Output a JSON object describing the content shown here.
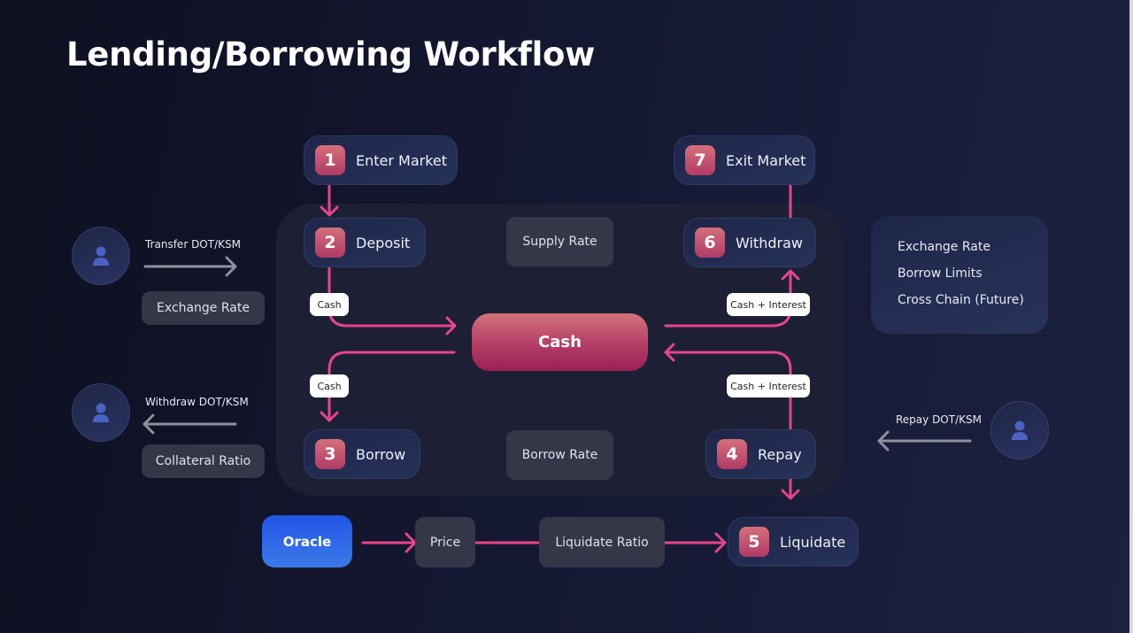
{
  "title": "Lending/Borrowing Workflow",
  "colors": {
    "accent_pink": "#e8458a",
    "badge": "#b03a66",
    "oracle_blue": "#2355e6",
    "arrow_gray": "#8e90a0"
  },
  "steps": [
    {
      "num": "1",
      "label": "Enter Market"
    },
    {
      "num": "2",
      "label": "Deposit"
    },
    {
      "num": "3",
      "label": "Borrow"
    },
    {
      "num": "4",
      "label": "Repay"
    },
    {
      "num": "5",
      "label": "Liquidate"
    },
    {
      "num": "6",
      "label": "Withdraw"
    },
    {
      "num": "7",
      "label": "Exit Market"
    }
  ],
  "center": {
    "cash": "Cash",
    "supply_rate": "Supply Rate",
    "borrow_rate": "Borrow Rate"
  },
  "flow_labels": {
    "deposit_cash": "Cash",
    "borrow_cash": "Cash",
    "withdraw": "Cash + Interest",
    "repay": "Cash + Interest"
  },
  "users": {
    "transfer": {
      "label": "Transfer DOT/KSM",
      "icon": "user-icon"
    },
    "withdraw": {
      "label": "Withdraw DOT/KSM",
      "icon": "user-icon"
    },
    "repay": {
      "label": "Repay DOT/KSM",
      "icon": "user-icon"
    }
  },
  "left_params": {
    "exchange_rate": "Exchange Rate",
    "collateral_ratio": "Collateral Ratio"
  },
  "info_box": [
    "Exchange Rate",
    "Borrow Limits",
    "Cross Chain (Future)"
  ],
  "liquidation": {
    "oracle": "Oracle",
    "price": "Price",
    "ratio": "Liquidate Ratio"
  }
}
